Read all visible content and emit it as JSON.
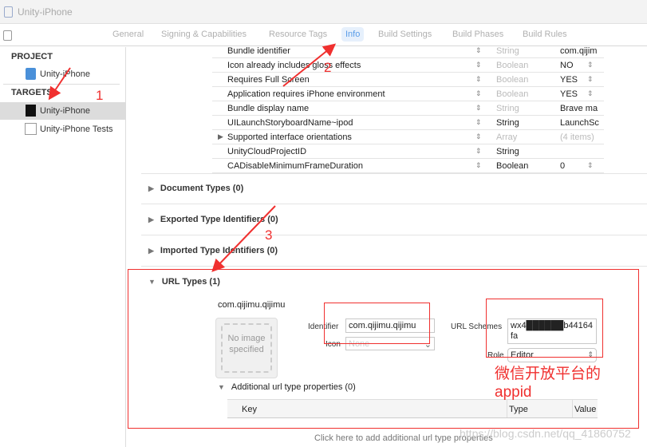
{
  "window": {
    "title": "Unity-iPhone"
  },
  "tabs": [
    "General",
    "Signing & Capabilities",
    "Resource Tags",
    "Info",
    "Build Settings",
    "Build Phases",
    "Build Rules"
  ],
  "active_tab": "Info",
  "sidebar": {
    "project_header": "PROJECT",
    "project": "Unity-iPhone",
    "targets_header": "TARGETS",
    "targets": [
      "Unity-iPhone",
      "Unity-iPhone Tests"
    ]
  },
  "info_rows": [
    {
      "key": "Bundle identifier",
      "type": "String",
      "value": "com.qijim"
    },
    {
      "key": "Icon already includes gloss effects",
      "type": "Boolean",
      "value": "NO"
    },
    {
      "key": "Requires Full Screen",
      "type": "Boolean",
      "value": "YES"
    },
    {
      "key": "Application requires iPhone environment",
      "type": "Boolean",
      "value": "YES"
    },
    {
      "key": "Bundle display name",
      "type": "String",
      "value": "Brave ma"
    },
    {
      "key": "UILaunchStoryboardName~ipod",
      "type": "String",
      "value": "LaunchSc"
    },
    {
      "key": "Supported interface orientations",
      "type": "Array",
      "value": "(4 items)"
    },
    {
      "key": "UnityCloudProjectID",
      "type": "String",
      "value": ""
    },
    {
      "key": "CADisableMinimumFrameDuration",
      "type": "Boolean",
      "value": "0"
    }
  ],
  "sections": [
    "Document Types (0)",
    "Exported Type Identifiers (0)",
    "Imported Type Identifiers (0)",
    "URL Types (1)"
  ],
  "url_type": {
    "name": "com.qijimu.qijimu",
    "no_image": "No image specified",
    "identifier_label": "Identifier",
    "identifier_value": "com.qijimu.qijimu",
    "icon_label": "Icon",
    "icon_placeholder": "None",
    "schemes_label": "URL Schemes",
    "schemes_value": "wx4██████b44164fa",
    "role_label": "Role",
    "role_value": "Editor",
    "additional": "Additional url type properties (0)",
    "columns": [
      "Key",
      "Type",
      "Value"
    ],
    "add_link": "Click here to add additional url type properties"
  },
  "annotations": {
    "n1": "1",
    "n2": "2",
    "n3": "3",
    "note": "微信开放平台的",
    "note2": "appid",
    "watermark": "https://blog.csdn.net/qq_41860752"
  },
  "colors": {
    "accent": "#5a9de8",
    "annotation": "#f0302f"
  }
}
